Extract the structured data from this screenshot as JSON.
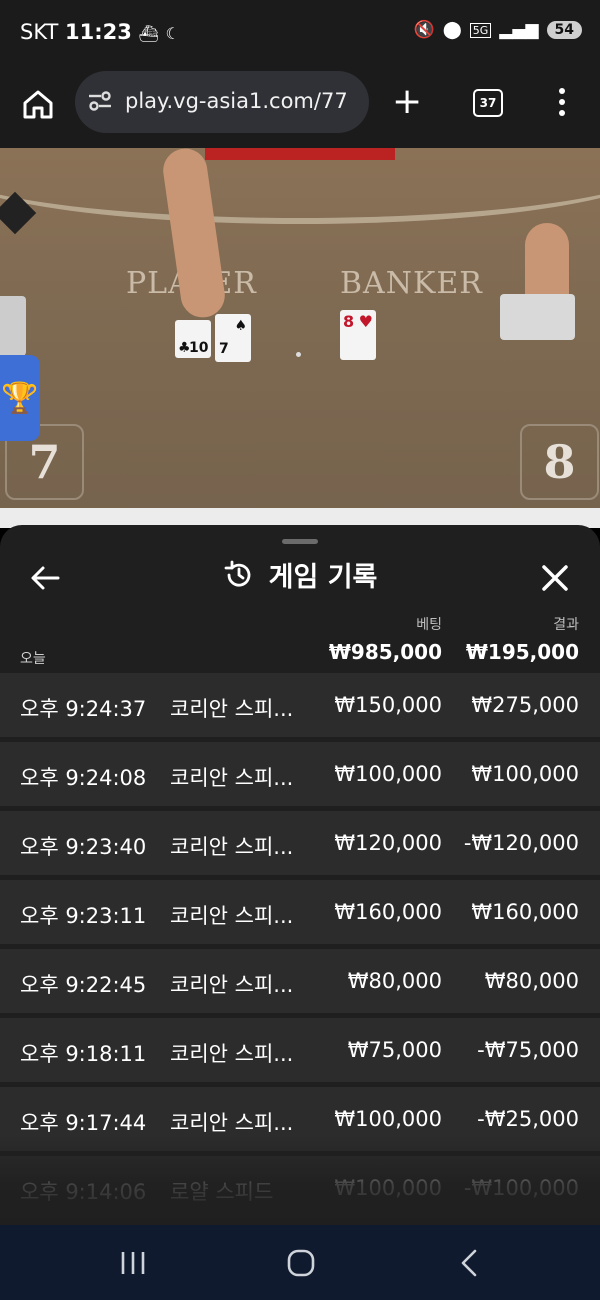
{
  "status_bar": {
    "carrier": "SKT",
    "time": "11:23",
    "network": "5G",
    "battery": "54"
  },
  "browser": {
    "url": "play.vg-asia1.com/77",
    "tab_count": "37"
  },
  "game": {
    "player_label": "PLAYER",
    "banker_label": "BANKER",
    "player_score": "7",
    "banker_score": "8",
    "player_cards": [
      {
        "rank": "10",
        "suit": "♣"
      },
      {
        "rank": "7",
        "suit": "♠"
      }
    ],
    "banker_cards": [
      {
        "rank": "8",
        "suit": "♥"
      }
    ]
  },
  "history": {
    "title": "게임 기록",
    "col_bet": "베팅",
    "col_result": "결과",
    "today_label": "오늘",
    "total_bet": "₩985,000",
    "total_result": "₩195,000",
    "rows": [
      {
        "time": "오후 9:24:37",
        "game": "코리안 스피...",
        "bet": "₩150,000",
        "result": "₩275,000"
      },
      {
        "time": "오후 9:24:08",
        "game": "코리안 스피...",
        "bet": "₩100,000",
        "result": "₩100,000"
      },
      {
        "time": "오후 9:23:40",
        "game": "코리안 스피...",
        "bet": "₩120,000",
        "result": "-₩120,000"
      },
      {
        "time": "오후 9:23:11",
        "game": "코리안 스피...",
        "bet": "₩160,000",
        "result": "₩160,000"
      },
      {
        "time": "오후 9:22:45",
        "game": "코리안 스피...",
        "bet": "₩80,000",
        "result": "₩80,000"
      },
      {
        "time": "오후 9:18:11",
        "game": "코리안 스피...",
        "bet": "₩75,000",
        "result": "-₩75,000"
      },
      {
        "time": "오후 9:17:44",
        "game": "코리안 스피...",
        "bet": "₩100,000",
        "result": "-₩25,000"
      },
      {
        "time": "오후 9:14:06",
        "game": "로얄 스피드",
        "bet": "₩100,000",
        "result": "-₩100,000"
      }
    ]
  }
}
